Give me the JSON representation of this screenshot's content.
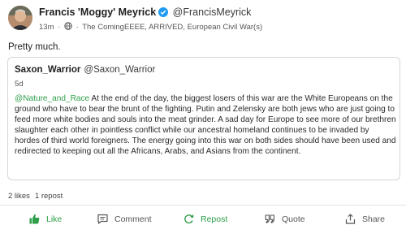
{
  "post": {
    "author_name": "Francis 'Moggy' Meyrick",
    "author_handle": "@FrancisMeyrick",
    "time": "13m",
    "group": "The ComingEEEE, ARRIVED, European Civil War(s)",
    "text": "Pretty much."
  },
  "quoted": {
    "author_name": "Saxon_Warrior",
    "author_handle": "@Saxon_Warrior",
    "time": "5d",
    "mention": "@Nature_and_Race",
    "body": " At the end of the day, the biggest losers of this war are the White Europeans on the ground who have to bear the brunt of the fighting. Putin and Zelensky are both jews who are just going to feed more white bodies and souls into the meat grinder. A sad day for Europe to see more of our brethren slaughter each other in pointless conflict while our ancestral homeland continues to be invaded by hordes of third world foreigners. The energy going into this war on both sides should have been used and redirected to keeping out all the Africans, Arabs, and Asians from the continent."
  },
  "stats": {
    "likes": "2 likes",
    "reposts": "1 repost"
  },
  "actions": {
    "like": "Like",
    "comment": "Comment",
    "repost": "Repost",
    "quote": "Quote",
    "share": "Share"
  },
  "colors": {
    "accent_green": "#2e9e4a",
    "verified_blue": "#1d9bf0"
  },
  "icons": [
    "verified-badge-icon",
    "globe-icon",
    "like-icon",
    "comment-icon",
    "repost-icon",
    "quote-icon",
    "share-icon"
  ]
}
